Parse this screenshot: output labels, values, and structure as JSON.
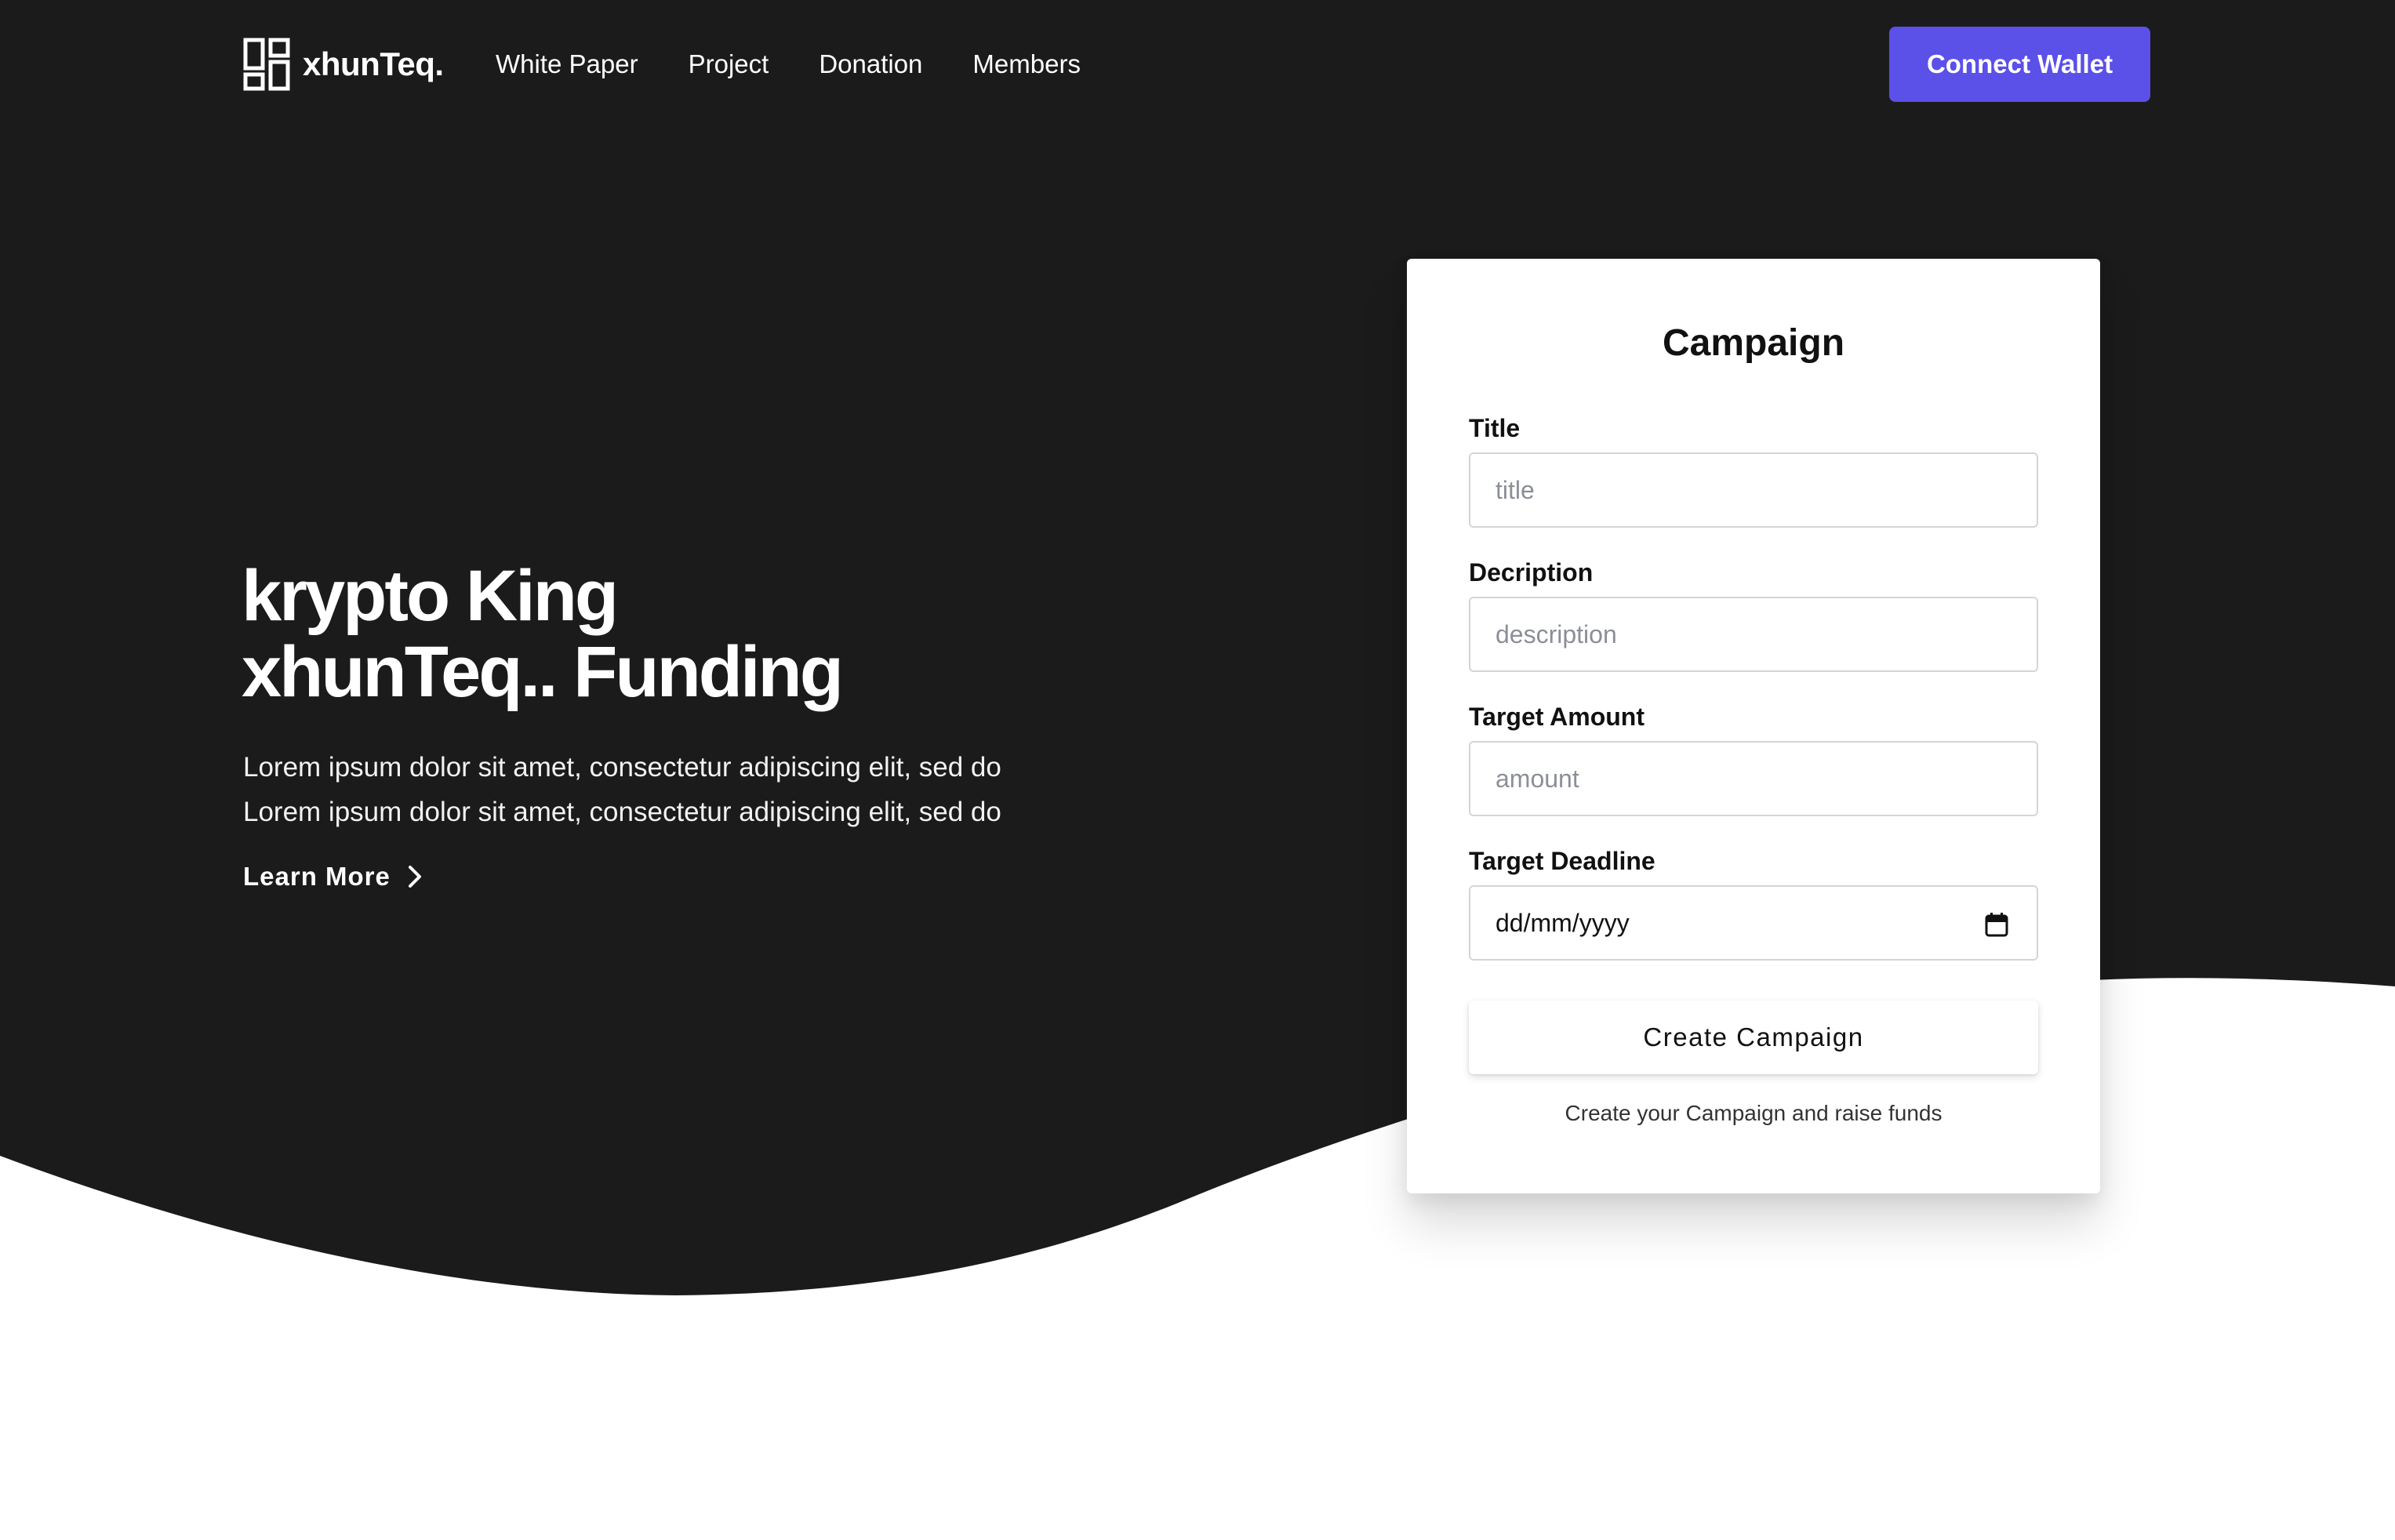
{
  "brand": {
    "name": "xhunTeq.",
    "icon": "logo-grid-icon"
  },
  "nav": {
    "items": [
      "White Paper",
      "Project",
      "Donation",
      "Members"
    ]
  },
  "header": {
    "connect_label": "Connect Wallet"
  },
  "hero": {
    "title_line1": "krypto King",
    "title_line2": "xhunTeq.. Funding",
    "desc_line1": "Lorem ipsum dolor sit amet, consectetur adipiscing elit, sed do",
    "desc_line2": "Lorem ipsum dolor sit amet, consectetur adipiscing elit, sed do",
    "learn_more": "Learn More"
  },
  "form": {
    "title": "Campaign",
    "fields": [
      {
        "label": "Title",
        "placeholder": "title"
      },
      {
        "label": "Decription",
        "placeholder": "description"
      },
      {
        "label": "Target Amount",
        "placeholder": "amount"
      },
      {
        "label": "Target Deadline",
        "value": "dd/mm/yyyy",
        "icon": "calendar-icon"
      }
    ],
    "submit_label": "Create Campaign",
    "note": "Create your Campaign and raise funds"
  },
  "colors": {
    "dark_bg": "#1b1b1c",
    "accent": "#5b50e8",
    "card_bg": "#ffffff"
  }
}
